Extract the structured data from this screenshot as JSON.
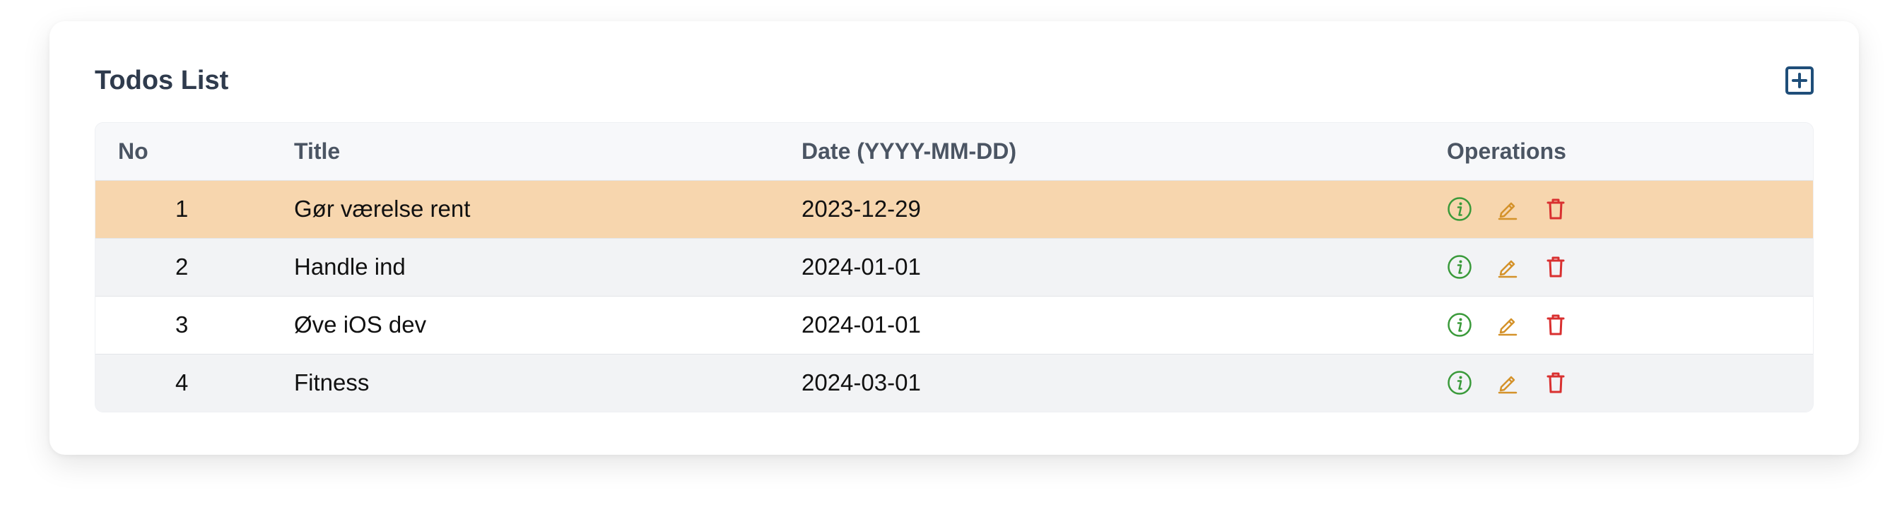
{
  "header": {
    "title": "Todos List",
    "add_icon": "plus-square-icon"
  },
  "table": {
    "columns": [
      "No",
      "Title",
      "Date (YYYY-MM-DD)",
      "Operations"
    ],
    "rows": [
      {
        "no": "1",
        "title": "Gør værelse rent",
        "date": "2023-12-29",
        "highlighted": true
      },
      {
        "no": "2",
        "title": "Handle ind",
        "date": "2024-01-01",
        "highlighted": false
      },
      {
        "no": "3",
        "title": "Øve iOS dev",
        "date": "2024-01-01",
        "highlighted": false
      },
      {
        "no": "4",
        "title": "Fitness",
        "date": "2024-03-01",
        "highlighted": false
      }
    ],
    "operation_icons": [
      "info-icon",
      "edit-pencil-icon",
      "delete-trash-icon"
    ]
  },
  "colors": {
    "title": "#2f3b4d",
    "add_button": "#1f4e79",
    "highlight_row": "#f7d6ae",
    "info": "#3a9a3a",
    "edit": "#d4922a",
    "delete": "#d93030"
  }
}
